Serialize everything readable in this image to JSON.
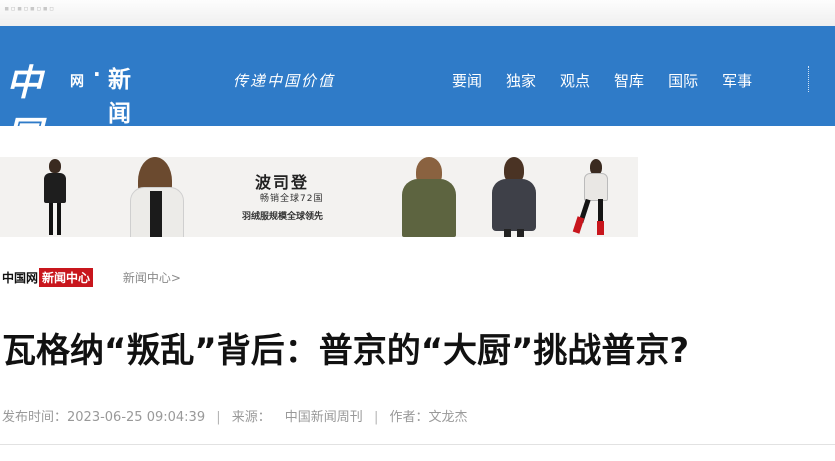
{
  "header": {
    "logo_main": "中国",
    "logo_wang": "网",
    "logo_dot": "·",
    "logo_sub": "新闻中心",
    "slogan": "传递中国价值",
    "nav": [
      {
        "label": "要闻"
      },
      {
        "label": "独家"
      },
      {
        "label": "观点"
      },
      {
        "label": "智库"
      },
      {
        "label": "国际"
      },
      {
        "label": "军事"
      }
    ],
    "brand_color": "#2f7bc8"
  },
  "ad_banner": {
    "brand": "波司登",
    "subline": "畅销全球72国",
    "slogan": "羽绒服规模全球领先"
  },
  "breadcrumb": {
    "site": "中国网",
    "section_tag": "新闻中心",
    "link": "新闻中心>",
    "tag_color": "#c8161d"
  },
  "article": {
    "title": "瓦格纳“叛乱”背后：普京的“大厨”挑战普京?",
    "meta": {
      "published_label": "发布时间：",
      "published": "2023-06-25 09:04:39",
      "sep": "|",
      "source_label": "来源：",
      "source": "中国新闻周刊",
      "author_label": "作者：",
      "author": "文龙杰"
    }
  }
}
